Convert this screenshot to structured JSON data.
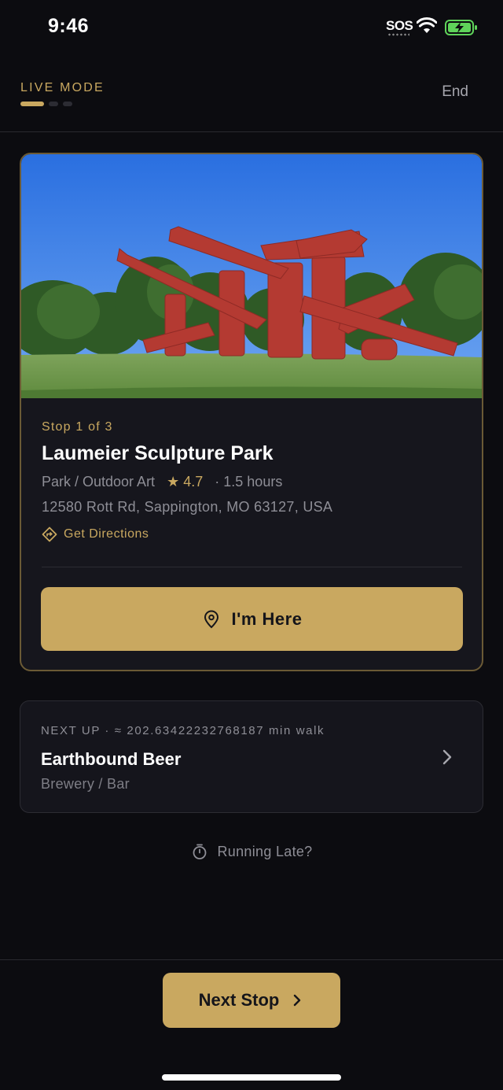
{
  "status_bar": {
    "time": "9:46",
    "carrier": "SOS"
  },
  "header": {
    "mode_label": "LIVE MODE",
    "progress_total": 3,
    "progress_current": 1,
    "end_label": "End"
  },
  "current_stop": {
    "counter": "Stop 1 of 3",
    "name": "Laumeier Sculpture Park",
    "category": "Park / Outdoor Art",
    "star": "★",
    "rating": "4.7",
    "duration": "· 1.5 hours",
    "address": "12580 Rott Rd, Sappington, MO 63127, USA",
    "directions_label": "Get Directions",
    "arrived_label": "I'm Here"
  },
  "next_up": {
    "label": "NEXT UP · ≈ 202.63422232768187 min walk",
    "name": "Earthbound Beer",
    "category": "Brewery / Bar"
  },
  "running_late_label": "Running Late?",
  "next_stop_label": "Next Stop",
  "colors": {
    "background": "#0c0c10",
    "card": "#16161d",
    "accent": "#c9a860",
    "muted_text": "#8e8e96",
    "card_border": "#6b5a35"
  },
  "icons": [
    "wifi-icon",
    "battery-charging-icon",
    "directions-icon",
    "map-pin-icon",
    "chevron-right-icon",
    "stopwatch-icon"
  ]
}
